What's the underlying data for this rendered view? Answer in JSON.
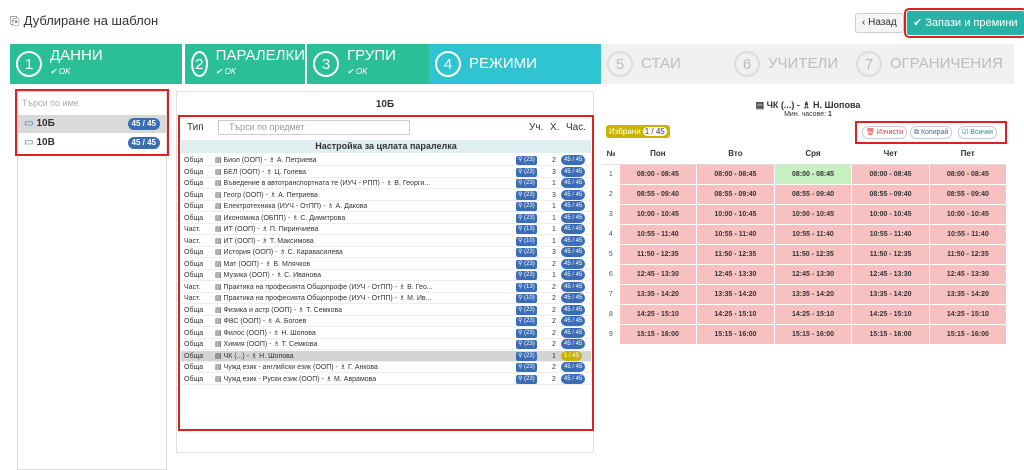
{
  "header": {
    "title": "Дублиране на шаблон",
    "title_icon": "copy-icon",
    "back_label": "‹ Назад",
    "save_label": "✔ Запази и премини"
  },
  "steps": [
    {
      "num": "1",
      "label": "ДАННИ",
      "status": "✔ OK"
    },
    {
      "num": "2",
      "label": "ПАРАЛЕЛКИ",
      "status": "✔ OK"
    },
    {
      "num": "3",
      "label": "ГРУПИ",
      "status": "✔ OK"
    },
    {
      "num": "4",
      "label": "РЕЖИМИ",
      "status": ""
    },
    {
      "num": "5",
      "label": "СТАИ",
      "status": ""
    },
    {
      "num": "6",
      "label": "УЧИТЕЛИ",
      "status": ""
    },
    {
      "num": "7",
      "label": "ОГРАНИЧЕНИЯ",
      "status": ""
    }
  ],
  "left": {
    "search_placeholder": "Търси по име",
    "classes": [
      {
        "name": "10Б",
        "badge": "45 / 45"
      },
      {
        "name": "10В",
        "badge": "45 / 45"
      }
    ]
  },
  "middle": {
    "title": "10Б",
    "col_type": "Тип",
    "search_placeholder": "Търси по предмет",
    "col_uch": "Уч.",
    "col_x": "Х.",
    "col_chas": "Час.",
    "whole_class": "Настройка за цялата паралелка",
    "rows": [
      {
        "type": "Обща",
        "name": "▤ Биол (ООП) - ♗ А. Петриева",
        "uch": "⚲ (23)",
        "x": "2",
        "hours": "45 / 45"
      },
      {
        "type": "Обща",
        "name": "▤ БЕЛ (ООП) - ♗ Ц. Голева",
        "uch": "⚲ (23)",
        "x": "3",
        "hours": "45 / 45"
      },
      {
        "type": "Обща",
        "name": "▤ Въведение в автотранспортната те (ИУЧ - РПП) - ♗ В. Георги...",
        "uch": "⚲ (23)",
        "x": "1",
        "hours": "45 / 45"
      },
      {
        "type": "Обща",
        "name": "▤ Геогр (ООП) - ♗ А. Петриева",
        "uch": "⚲ (23)",
        "x": "3",
        "hours": "45 / 45"
      },
      {
        "type": "Обща",
        "name": "▤ Електротехника (ИУЧ - ОтПП) - ♗ А. Дакова",
        "uch": "⚲ (23)",
        "x": "1",
        "hours": "45 / 45"
      },
      {
        "type": "Обща",
        "name": "▤ Икономика (ОБПП) - ♗ С. Димитрова",
        "uch": "⚲ (23)",
        "x": "1",
        "hours": "45 / 45"
      },
      {
        "type": "Част.",
        "name": "▤ ИТ (ООП) - ♗ П. Пиринчиева",
        "uch": "⚲ (13)",
        "x": "1",
        "hours": "45 / 45"
      },
      {
        "type": "Част.",
        "name": "▤ ИТ (ООП) - ♗ Т. Максимова",
        "uch": "⚲ (10)",
        "x": "1",
        "hours": "45 / 45"
      },
      {
        "type": "Обща",
        "name": "▤ История (ООП) - ♗ С. Каравасилева",
        "uch": "⚲ (23)",
        "x": "3",
        "hours": "45 / 45"
      },
      {
        "type": "Обща",
        "name": "▤ Мат (ООП) - ♗ В. Млячков",
        "uch": "⚲ (23)",
        "x": "2",
        "hours": "45 / 45"
      },
      {
        "type": "Обща",
        "name": "▤ Музика (ООП) - ♗ С. Иванова",
        "uch": "⚲ (23)",
        "x": "1",
        "hours": "45 / 45"
      },
      {
        "type": "Част.",
        "name": "▤ Практика на професията Общопрофе (ИУЧ - ОтПП) - ♗ В. Гео...",
        "uch": "⚲ (13)",
        "x": "2",
        "hours": "45 / 45"
      },
      {
        "type": "Част.",
        "name": "▤ Практика на професията Общопрофе (ИУЧ - ОтПП) - ♗ М. Ив...",
        "uch": "⚲ (10)",
        "x": "2",
        "hours": "45 / 45"
      },
      {
        "type": "Обща",
        "name": "▤ Физика и астр (ООП) - ♗ Т. Семкова",
        "uch": "⚲ (23)",
        "x": "2",
        "hours": "45 / 45"
      },
      {
        "type": "Обща",
        "name": "▤ ФВС (ООП) - ♗ А. Богоев",
        "uch": "⚲ (23)",
        "x": "2",
        "hours": "45 / 45"
      },
      {
        "type": "Обща",
        "name": "▤ Филос (ООП) - ♗ Н. Шопова",
        "uch": "⚲ (23)",
        "x": "2",
        "hours": "45 / 45"
      },
      {
        "type": "Обща",
        "name": "▤ Химия (ООП) - ♗ Т. Семкова",
        "uch": "⚲ (23)",
        "x": "2",
        "hours": "45 / 45"
      },
      {
        "type": "Обща",
        "name": "▤ ЧК (...) - ♗ Н. Шопова",
        "uch": "⚲ (23)",
        "x": "1",
        "hours": "1 / 45"
      },
      {
        "type": "Обща",
        "name": "▤ Чужд език - английски език (ООП) - ♗ Г. Анкова",
        "uch": "⚲ (23)",
        "x": "2",
        "hours": "45 / 45"
      },
      {
        "type": "Обща",
        "name": "▤ Чужд език - Руски език (ООП) - ♗ М. Аврамова",
        "uch": "⚲ (23)",
        "x": "2",
        "hours": "45 / 45"
      }
    ]
  },
  "right": {
    "title": "▤ ЧК (...) - ♗ Н. Шопова",
    "min_hours_label": "Мин. часове:",
    "min_hours_value": "1",
    "selected_label": "Избрани",
    "selected_count": "1 / 45",
    "clear_label": "🗑 Изчисти",
    "copy_label": "⧉ Копирай",
    "all_label": "☑ Всички",
    "days": [
      "№",
      "Пон",
      "Вто",
      "Сря",
      "Чет",
      "Пет"
    ],
    "periods": [
      {
        "no": "1",
        "time": "08:00 - 08:45"
      },
      {
        "no": "2",
        "time": "08:55 - 09:40"
      },
      {
        "no": "3",
        "time": "10:00 - 10:45"
      },
      {
        "no": "4",
        "time": "10:55 - 11:40"
      },
      {
        "no": "5",
        "time": "11:50 - 12:35"
      },
      {
        "no": "6",
        "time": "12:45 - 13:30"
      },
      {
        "no": "7",
        "time": "13:35 - 14:20"
      },
      {
        "no": "8",
        "time": "14:25 - 15:10"
      },
      {
        "no": "9",
        "time": "15:15 - 16:00"
      }
    ]
  },
  "colors": {
    "done": "#2bbf97",
    "active": "#30c3d0",
    "blocked": "#f7c1c1",
    "free": "#c7f0c2",
    "badge": "#3a6db5",
    "highlight": "#e02020"
  }
}
